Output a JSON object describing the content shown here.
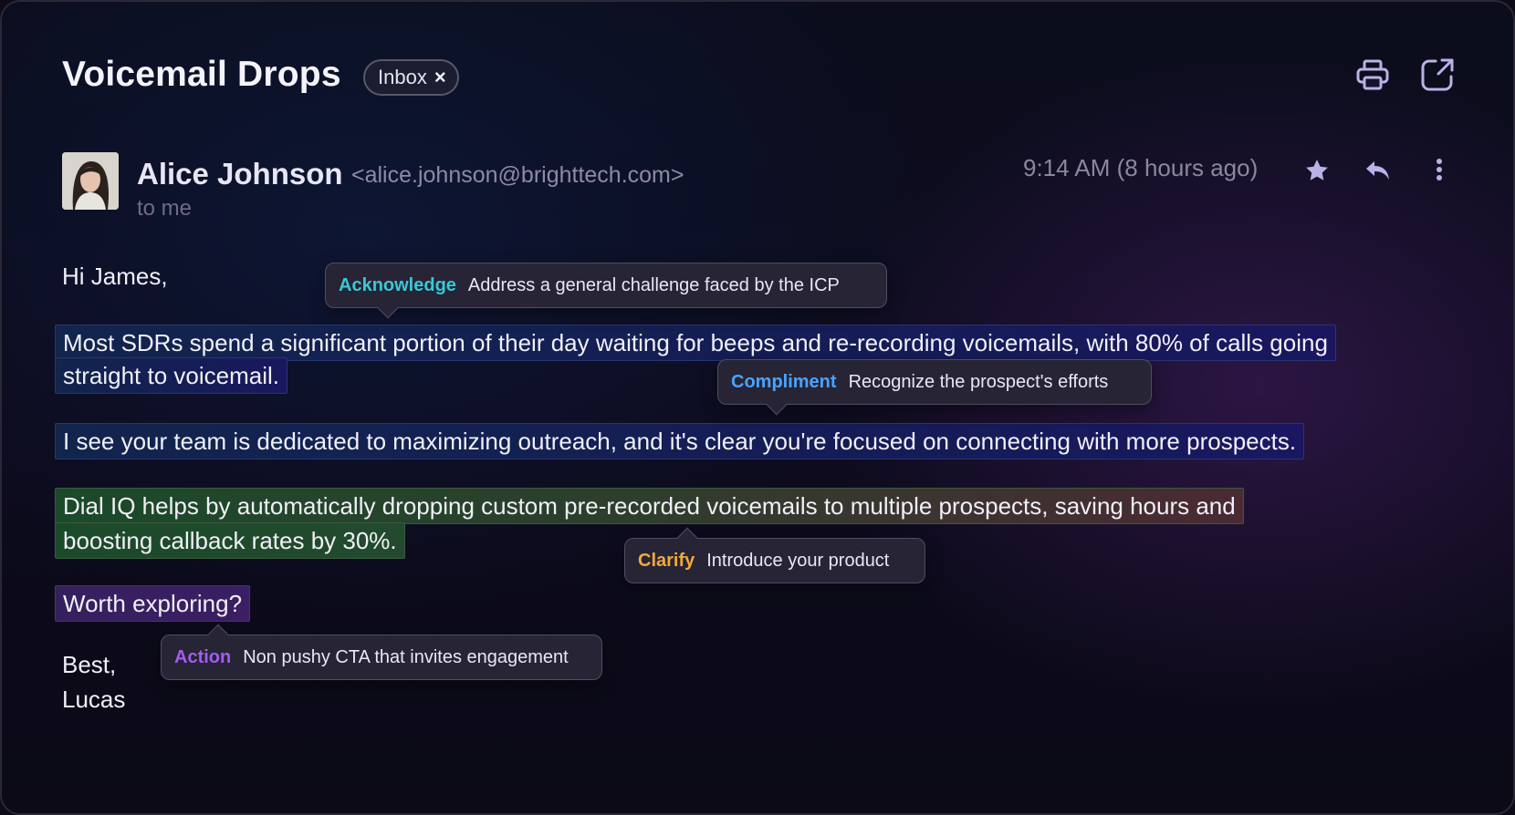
{
  "header": {
    "subject": "Voicemail Drops",
    "label_chip": "Inbox",
    "chip_close": "×",
    "actions": [
      {
        "name": "print-icon"
      },
      {
        "name": "open-in-new-window-icon"
      }
    ]
  },
  "message": {
    "sender_name": "Alice Johnson",
    "sender_email": "<alice.johnson@brighttech.com>",
    "recipient": "to me",
    "time": "9:14 AM  (8 hours ago)",
    "actions": [
      {
        "name": "star-icon",
        "color": "#b9b2e6"
      },
      {
        "name": "reply-icon",
        "color": "#b9b2e6"
      },
      {
        "name": "more-vertical-icon",
        "color": "#b9b2e6"
      }
    ],
    "body": {
      "greeting": "Hi James,",
      "p1_line1": "Most SDRs spend a significant portion of their day waiting for beeps and re-recording voicemails, with 80% of calls going",
      "p1_line2": "straight to voicemail.",
      "p2": "I see your team is dedicated to maximizing outreach, and it's clear you're focused on connecting with more prospects.",
      "p3_line1": "Dial IQ helps by automatically dropping custom pre-recorded voicemails to multiple prospects, saving hours and",
      "p3_line2": "boosting callback rates by 30%.",
      "p4": "Worth exploring?",
      "signoff": "Best,",
      "signature": "Lucas"
    }
  },
  "annotations": [
    {
      "tag": "Acknowledge",
      "text": "Address a general challenge faced by the ICP",
      "color": "#39c7d6"
    },
    {
      "tag": "Compliment",
      "text": "Recognize the prospect's efforts",
      "color": "#4aa3ff"
    },
    {
      "tag": "Clarify",
      "text": "Introduce your product",
      "color": "#f2a93b"
    },
    {
      "tag": "Action",
      "text": "Non pushy CTA that invites engagement",
      "color": "#a35cf0"
    }
  ]
}
